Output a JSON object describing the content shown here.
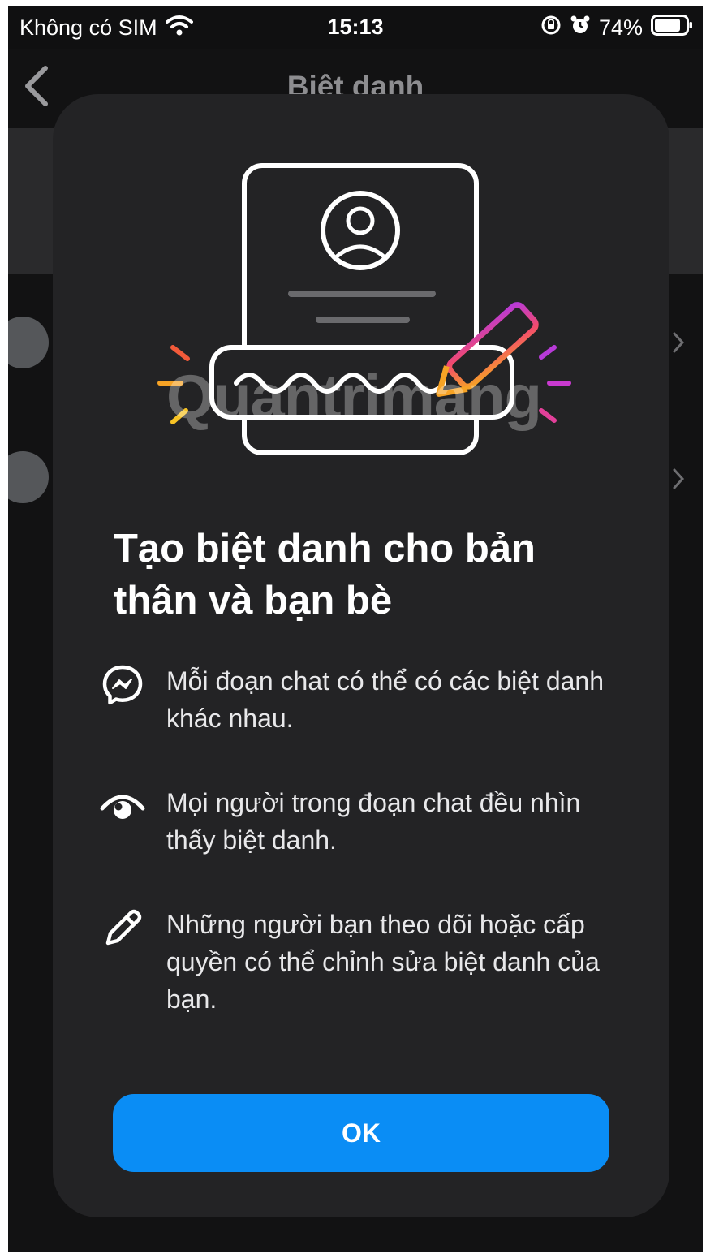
{
  "status_bar": {
    "carrier": "Không có SIM",
    "time": "15:13",
    "battery": "74%",
    "icons": [
      "wifi-icon",
      "rotation-lock-icon",
      "alarm-icon",
      "battery-icon"
    ]
  },
  "header": {
    "title": "Biệt danh",
    "back_icon": "chevron-left-icon"
  },
  "modal": {
    "title": "Tạo biệt danh cho bản thân và bạn bè",
    "watermark": "Quantrimang",
    "features": [
      {
        "icon": "messenger-icon",
        "text": "Mỗi đoạn chat có thể có các biệt danh khác nhau."
      },
      {
        "icon": "eye-icon",
        "text": "Mọi người trong đoạn chat đều nhìn thấy biệt danh."
      },
      {
        "icon": "pencil-icon",
        "text": "Những người bạn theo dõi hoặc cấp quyền có thể chỉnh sửa biệt danh của bạn."
      }
    ],
    "ok_label": "OK"
  },
  "colors": {
    "background": "#101011",
    "modal": "#232325",
    "accent": "#0a8df5",
    "text": "#ffffff"
  }
}
